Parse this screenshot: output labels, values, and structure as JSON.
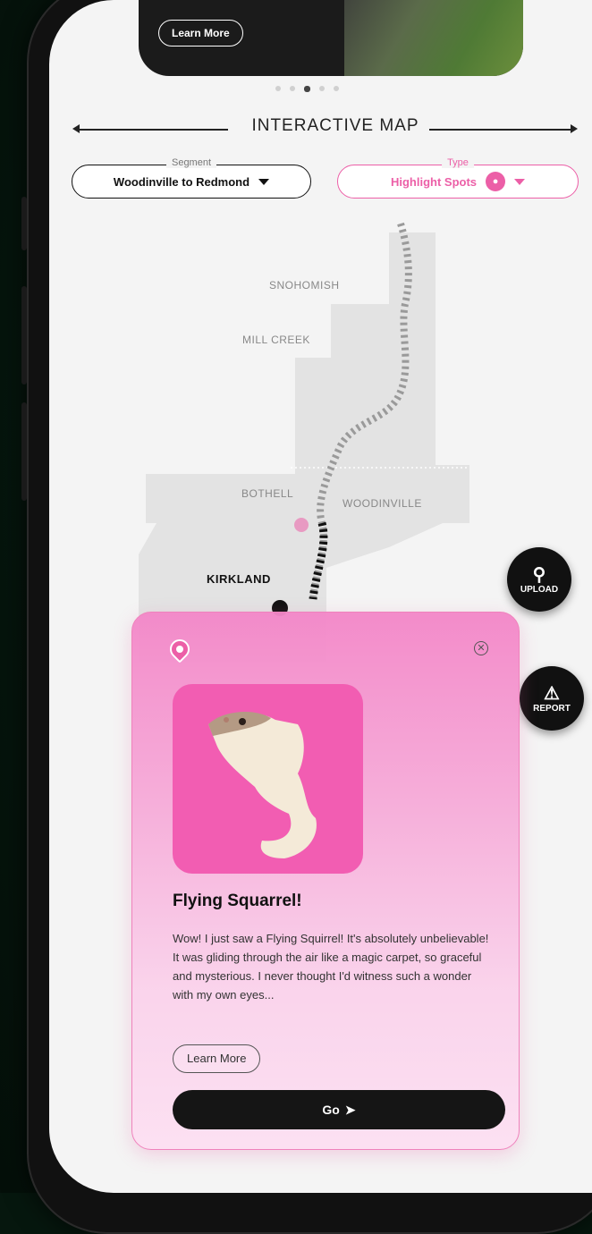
{
  "banner": {
    "learn_more": "Learn More"
  },
  "carousel": {
    "count": 5,
    "active_index": 2
  },
  "section": {
    "title": "INTERACTIVE MAP"
  },
  "filters": {
    "segment": {
      "legend": "Segment",
      "value": "Woodinville to Redmond"
    },
    "type": {
      "legend": "Type",
      "value": "Highlight Spots",
      "icon": "map-pin-icon"
    }
  },
  "map": {
    "labels": {
      "snohomish": "SNOHOMISH",
      "mill_creek": "MILL CREEK",
      "bothell": "BOTHELL",
      "woodinville": "WOODINVILLE",
      "kirkland": "KIRKLAND"
    }
  },
  "actions": {
    "upload": {
      "label": "UPLOAD",
      "icon": "map-pin-upload-icon"
    },
    "report": {
      "label": "REPORT",
      "icon": "clipboard-warning-icon"
    }
  },
  "card": {
    "title": "Flying Squarrel!",
    "body": "Wow! I just saw a Flying Squirrel! It's absolutely unbelievable! It was gliding through the air like a magic carpet, so graceful and mysterious. I never thought I'd witness such a wonder with my own eyes...",
    "learn_more": "Learn More",
    "go": "Go",
    "accent_color": "#ec5fa7"
  }
}
